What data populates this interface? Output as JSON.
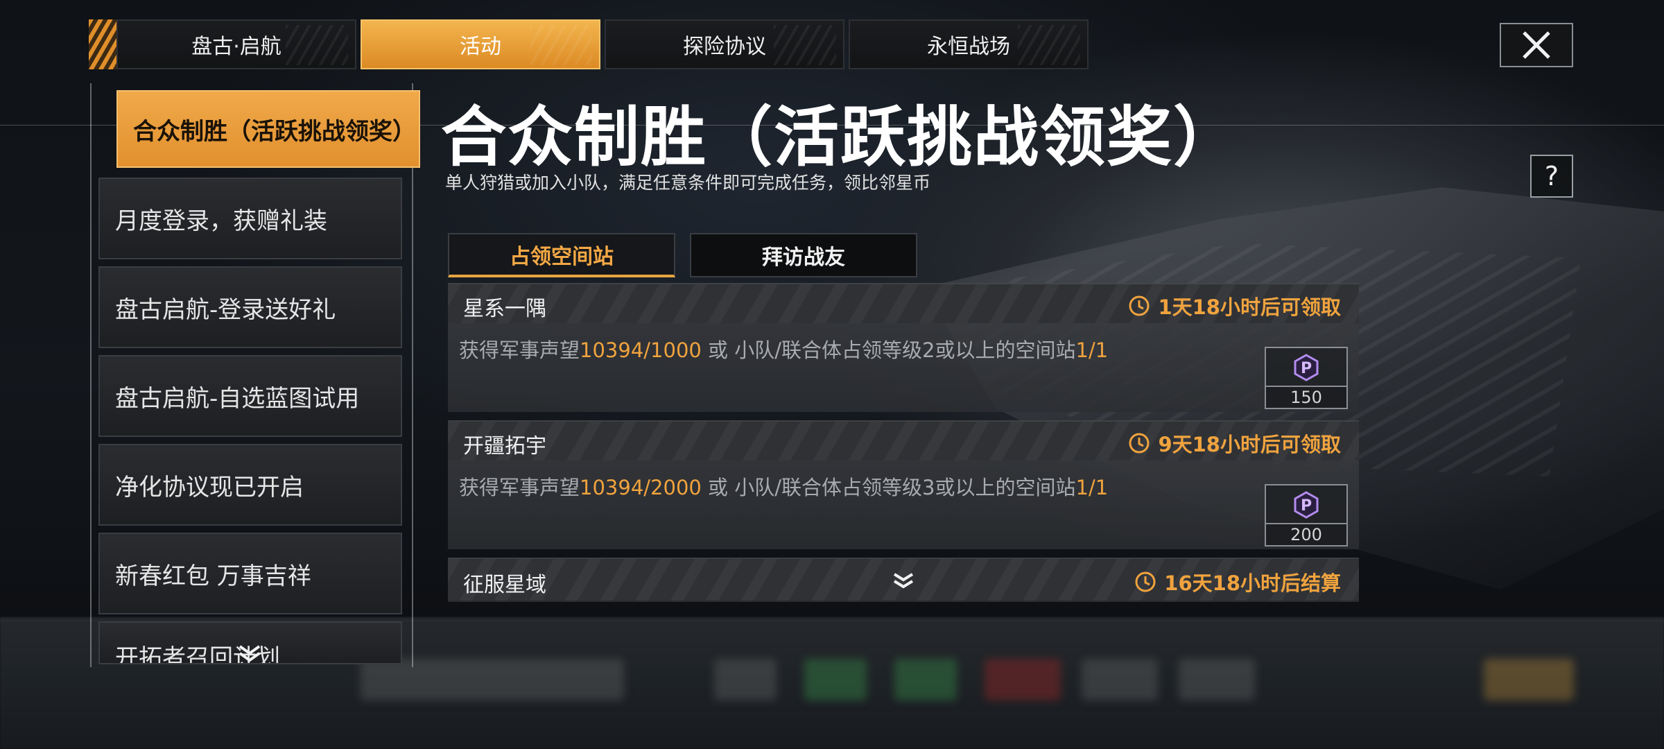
{
  "top_tabs": [
    {
      "label": "盘古·启航",
      "active": false
    },
    {
      "label": "活动",
      "active": true
    },
    {
      "label": "探险协议",
      "active": false
    },
    {
      "label": "永恒战场",
      "active": false
    }
  ],
  "sidebar": {
    "items": [
      {
        "label": "合众制胜（活跃挑战领奖）",
        "active": true
      },
      {
        "label": "月度登录，获赠礼装",
        "active": false
      },
      {
        "label": "盘古启航-登录送好礼",
        "active": false
      },
      {
        "label": "盘古启航-自选蓝图试用",
        "active": false
      },
      {
        "label": "净化协议现已开启",
        "active": false
      },
      {
        "label": "新春红包 万事吉祥",
        "active": false
      },
      {
        "label": "开拓者召回计划",
        "active": false
      }
    ]
  },
  "main": {
    "title": "合众制胜（活跃挑战领奖）",
    "subtitle": "单人狩猎或加入小队，满足任意条件即可完成任务，领比邻星币",
    "help_label": "?",
    "subtabs": [
      {
        "label": "占领空间站",
        "active": true
      },
      {
        "label": "拜访战友",
        "active": false
      }
    ],
    "tasks": [
      {
        "name": "星系一隅",
        "time": "1天18小时后可领取",
        "desc_prefix": "获得军事声望",
        "desc_value1": "10394/1000",
        "desc_middle": " 或 小队/联合体占领等级2或以上的空间站",
        "desc_value2": "1/1",
        "reward_count": "150"
      },
      {
        "name": "开疆拓宇",
        "time": "9天18小时后可领取",
        "desc_prefix": "获得军事声望",
        "desc_value1": "10394/2000",
        "desc_middle": " 或 小队/联合体占领等级3或以上的空间站",
        "desc_value2": "1/1",
        "reward_count": "200"
      },
      {
        "name": "征服星域",
        "time": "16天18小时后结算"
      }
    ]
  },
  "colors": {
    "accent_orange": "#f0a33e",
    "active_tab": "#e2902e",
    "reward_purple": "#b48cf0"
  },
  "icons": [
    "close-icon",
    "help-icon",
    "clock-icon",
    "chevron-down-icon",
    "currency-icon"
  ]
}
